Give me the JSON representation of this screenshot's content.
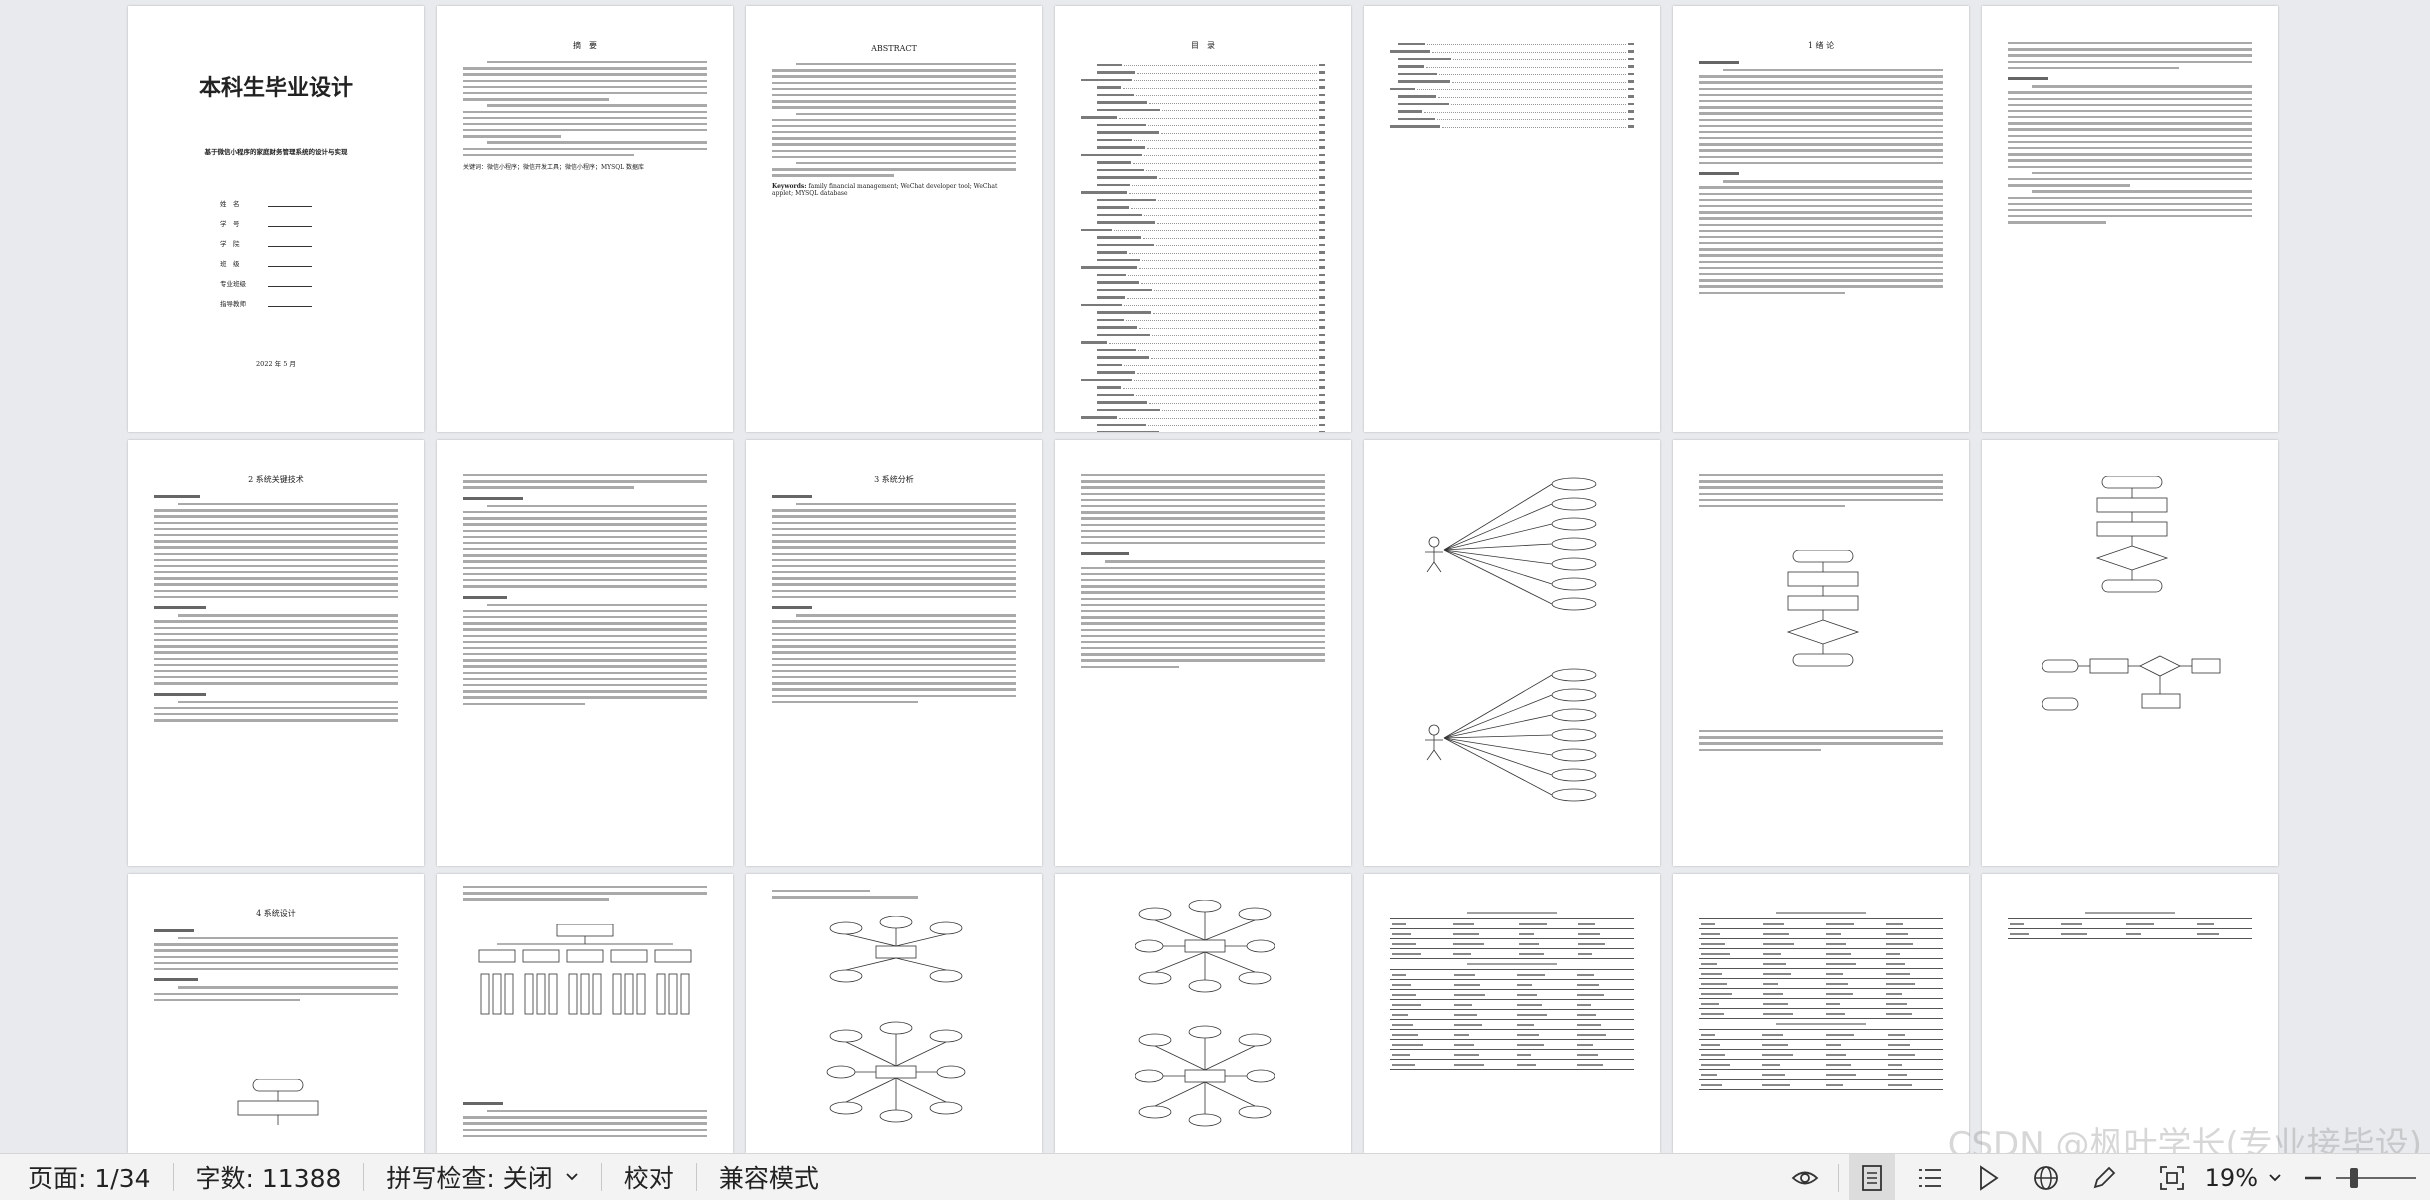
{
  "document": {
    "cover": {
      "title": "本科生毕业设计",
      "subtitle": "基于微信小程序的家庭财务管理系统的设计与实现",
      "fields": [
        "姓　名",
        "学　号",
        "学　院",
        "班　级",
        "专业班级",
        "指导教师"
      ],
      "date": "2022 年 5 月"
    },
    "abstract_cn": {
      "heading": "摘　要",
      "keywords": "关键词：微信小程序；微信开发工具；微信小程序；MYSQL 数据库"
    },
    "abstract_en": {
      "heading": "ABSTRACT",
      "keywords_label": "Keywords:",
      "keywords": "family financial management; WeChat developer tool; WeChat applet; MYSQL database"
    },
    "toc": {
      "heading": "目　录"
    },
    "chapters": {
      "ch1": "1 绪 论",
      "ch2": "2 系统关键技术",
      "ch3": "3 系统分析",
      "ch4": "4 系统设计"
    }
  },
  "statusbar": {
    "page": "页面: 1/34",
    "wordcount": "字数: 11388",
    "spellcheck": "拼写检查: 关闭",
    "proofread": "校对",
    "compat": "兼容模式",
    "zoom": "19%",
    "zoom_fraction": 0.19
  },
  "watermark": "CSDN @枫叶学长(专业接毕设)"
}
